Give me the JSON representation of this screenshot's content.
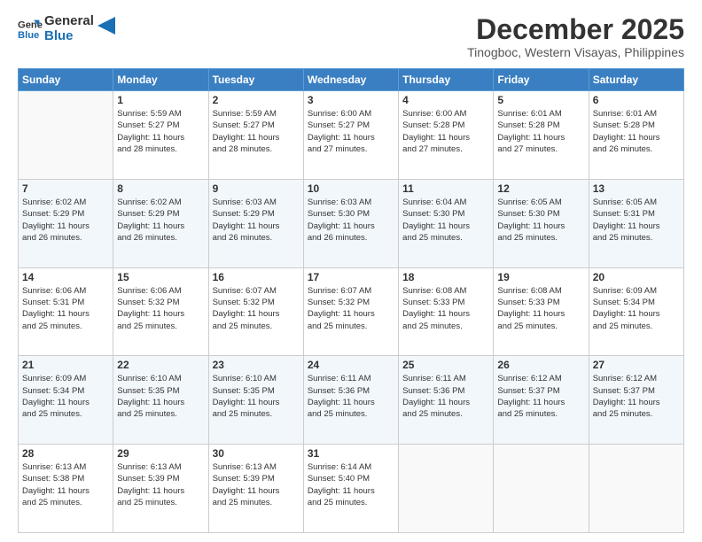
{
  "logo": {
    "line1": "General",
    "line2": "Blue"
  },
  "title": "December 2025",
  "subtitle": "Tinogboc, Western Visayas, Philippines",
  "days_of_week": [
    "Sunday",
    "Monday",
    "Tuesday",
    "Wednesday",
    "Thursday",
    "Friday",
    "Saturday"
  ],
  "weeks": [
    [
      {
        "num": "",
        "info": ""
      },
      {
        "num": "1",
        "info": "Sunrise: 5:59 AM\nSunset: 5:27 PM\nDaylight: 11 hours\nand 28 minutes."
      },
      {
        "num": "2",
        "info": "Sunrise: 5:59 AM\nSunset: 5:27 PM\nDaylight: 11 hours\nand 28 minutes."
      },
      {
        "num": "3",
        "info": "Sunrise: 6:00 AM\nSunset: 5:27 PM\nDaylight: 11 hours\nand 27 minutes."
      },
      {
        "num": "4",
        "info": "Sunrise: 6:00 AM\nSunset: 5:28 PM\nDaylight: 11 hours\nand 27 minutes."
      },
      {
        "num": "5",
        "info": "Sunrise: 6:01 AM\nSunset: 5:28 PM\nDaylight: 11 hours\nand 27 minutes."
      },
      {
        "num": "6",
        "info": "Sunrise: 6:01 AM\nSunset: 5:28 PM\nDaylight: 11 hours\nand 26 minutes."
      }
    ],
    [
      {
        "num": "7",
        "info": "Sunrise: 6:02 AM\nSunset: 5:29 PM\nDaylight: 11 hours\nand 26 minutes."
      },
      {
        "num": "8",
        "info": "Sunrise: 6:02 AM\nSunset: 5:29 PM\nDaylight: 11 hours\nand 26 minutes."
      },
      {
        "num": "9",
        "info": "Sunrise: 6:03 AM\nSunset: 5:29 PM\nDaylight: 11 hours\nand 26 minutes."
      },
      {
        "num": "10",
        "info": "Sunrise: 6:03 AM\nSunset: 5:30 PM\nDaylight: 11 hours\nand 26 minutes."
      },
      {
        "num": "11",
        "info": "Sunrise: 6:04 AM\nSunset: 5:30 PM\nDaylight: 11 hours\nand 25 minutes."
      },
      {
        "num": "12",
        "info": "Sunrise: 6:05 AM\nSunset: 5:30 PM\nDaylight: 11 hours\nand 25 minutes."
      },
      {
        "num": "13",
        "info": "Sunrise: 6:05 AM\nSunset: 5:31 PM\nDaylight: 11 hours\nand 25 minutes."
      }
    ],
    [
      {
        "num": "14",
        "info": "Sunrise: 6:06 AM\nSunset: 5:31 PM\nDaylight: 11 hours\nand 25 minutes."
      },
      {
        "num": "15",
        "info": "Sunrise: 6:06 AM\nSunset: 5:32 PM\nDaylight: 11 hours\nand 25 minutes."
      },
      {
        "num": "16",
        "info": "Sunrise: 6:07 AM\nSunset: 5:32 PM\nDaylight: 11 hours\nand 25 minutes."
      },
      {
        "num": "17",
        "info": "Sunrise: 6:07 AM\nSunset: 5:32 PM\nDaylight: 11 hours\nand 25 minutes."
      },
      {
        "num": "18",
        "info": "Sunrise: 6:08 AM\nSunset: 5:33 PM\nDaylight: 11 hours\nand 25 minutes."
      },
      {
        "num": "19",
        "info": "Sunrise: 6:08 AM\nSunset: 5:33 PM\nDaylight: 11 hours\nand 25 minutes."
      },
      {
        "num": "20",
        "info": "Sunrise: 6:09 AM\nSunset: 5:34 PM\nDaylight: 11 hours\nand 25 minutes."
      }
    ],
    [
      {
        "num": "21",
        "info": "Sunrise: 6:09 AM\nSunset: 5:34 PM\nDaylight: 11 hours\nand 25 minutes."
      },
      {
        "num": "22",
        "info": "Sunrise: 6:10 AM\nSunset: 5:35 PM\nDaylight: 11 hours\nand 25 minutes."
      },
      {
        "num": "23",
        "info": "Sunrise: 6:10 AM\nSunset: 5:35 PM\nDaylight: 11 hours\nand 25 minutes."
      },
      {
        "num": "24",
        "info": "Sunrise: 6:11 AM\nSunset: 5:36 PM\nDaylight: 11 hours\nand 25 minutes."
      },
      {
        "num": "25",
        "info": "Sunrise: 6:11 AM\nSunset: 5:36 PM\nDaylight: 11 hours\nand 25 minutes."
      },
      {
        "num": "26",
        "info": "Sunrise: 6:12 AM\nSunset: 5:37 PM\nDaylight: 11 hours\nand 25 minutes."
      },
      {
        "num": "27",
        "info": "Sunrise: 6:12 AM\nSunset: 5:37 PM\nDaylight: 11 hours\nand 25 minutes."
      }
    ],
    [
      {
        "num": "28",
        "info": "Sunrise: 6:13 AM\nSunset: 5:38 PM\nDaylight: 11 hours\nand 25 minutes."
      },
      {
        "num": "29",
        "info": "Sunrise: 6:13 AM\nSunset: 5:39 PM\nDaylight: 11 hours\nand 25 minutes."
      },
      {
        "num": "30",
        "info": "Sunrise: 6:13 AM\nSunset: 5:39 PM\nDaylight: 11 hours\nand 25 minutes."
      },
      {
        "num": "31",
        "info": "Sunrise: 6:14 AM\nSunset: 5:40 PM\nDaylight: 11 hours\nand 25 minutes."
      },
      {
        "num": "",
        "info": ""
      },
      {
        "num": "",
        "info": ""
      },
      {
        "num": "",
        "info": ""
      }
    ]
  ]
}
